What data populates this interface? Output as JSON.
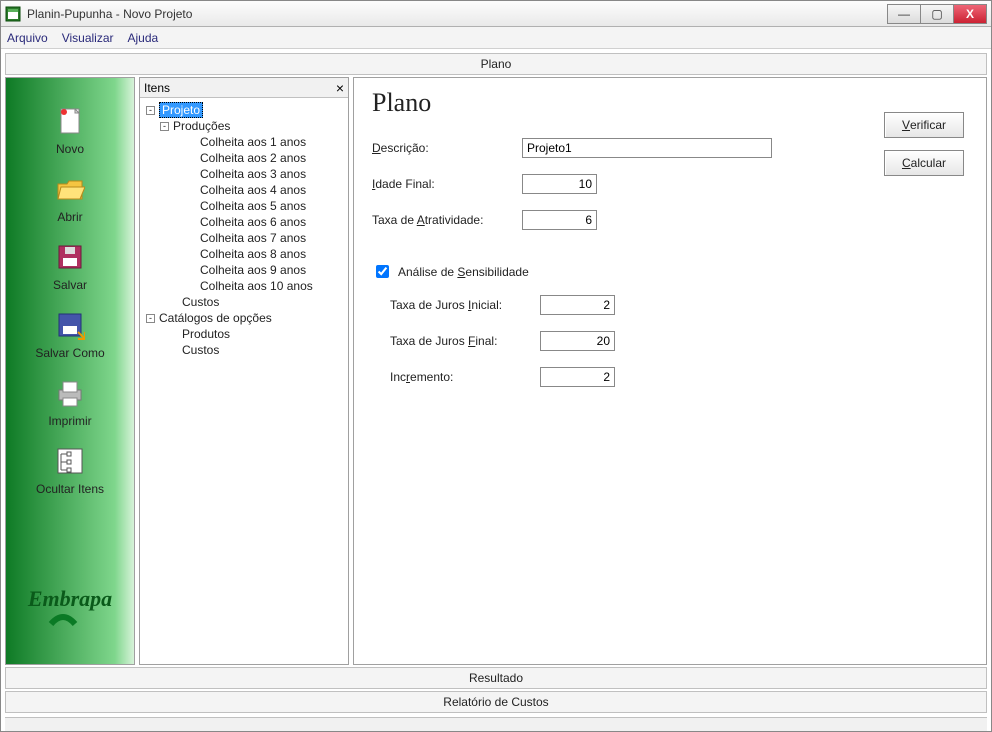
{
  "window": {
    "title": "Planin-Pupunha - Novo Projeto",
    "controls": {
      "minimize": "—",
      "maximize": "▢",
      "close": "X"
    }
  },
  "menu": {
    "arquivo": "Arquivo",
    "visualizar": "Visualizar",
    "ajuda": "Ajuda"
  },
  "top_tab_label": "Plano",
  "sidebar": {
    "novo": "Novo",
    "abrir": "Abrir",
    "salvar": "Salvar",
    "salvar_como": "Salvar Como",
    "imprimir": "Imprimir",
    "ocultar_itens": "Ocultar Itens",
    "brand": "Embrapa"
  },
  "tree": {
    "header": "Itens",
    "projeto": "Projeto",
    "producoes": "Produções",
    "colheitas": [
      "Colheita aos 1 anos",
      "Colheita aos 2 anos",
      "Colheita aos 3 anos",
      "Colheita aos 4 anos",
      "Colheita aos 5 anos",
      "Colheita aos 6 anos",
      "Colheita aos 7 anos",
      "Colheita aos 8 anos",
      "Colheita aos 9 anos",
      "Colheita aos 10 anos"
    ],
    "custos": "Custos",
    "catalogos": "Catálogos de opções",
    "produtos": "Produtos",
    "custos2": "Custos"
  },
  "form": {
    "title": "Plano",
    "labels": {
      "descricao_pre": "D",
      "descricao_post": "escrição:",
      "idade_pre": "I",
      "idade_post": "dade Final:",
      "atrat_pre": "Taxa de ",
      "atrat_u": "A",
      "atrat_post": "tratividade:",
      "analise_pre": "Análise de ",
      "analise_u": "S",
      "analise_post": "ensibilidade",
      "juros_ini_pre": "Taxa de Juros ",
      "juros_ini_u": "I",
      "juros_ini_post": "nicial:",
      "juros_fin_pre": "Taxa de Juros ",
      "juros_fin_u": "F",
      "juros_fin_post": "inal:",
      "incremento_pre": "Inc",
      "incremento_u": "r",
      "incremento_post": "emento:"
    },
    "values": {
      "descricao": "Projeto1",
      "idade_final": "10",
      "atratividade": "6",
      "analise_checked": true,
      "juros_inicial": "2",
      "juros_final": "20",
      "incremento": "2"
    },
    "buttons": {
      "verificar_u": "V",
      "verificar_post": "erificar",
      "calcular_u": "C",
      "calcular_post": "alcular"
    }
  },
  "tabs": {
    "resultado": "Resultado",
    "relatorio": "Relatório de Custos"
  }
}
